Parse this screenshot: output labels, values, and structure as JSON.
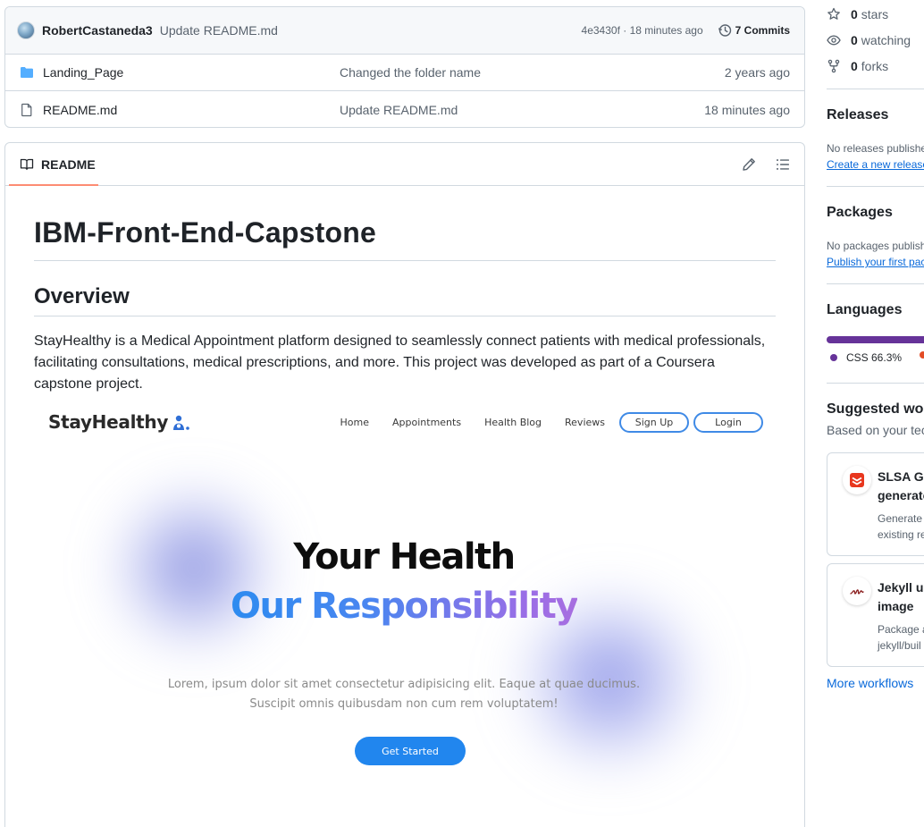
{
  "commit": {
    "author": "RobertCastaneda3",
    "message": "Update README.md",
    "hash_time": "4e3430f · 18 minutes ago",
    "commits_label": "7 Commits"
  },
  "files": [
    {
      "name": "Landing_Page",
      "type": "folder",
      "commit": "Changed the folder name",
      "date": "2 years ago"
    },
    {
      "name": "README.md",
      "type": "file",
      "commit": "Update README.md",
      "date": "18 minutes ago"
    }
  ],
  "readme": {
    "tab_label": "README",
    "title": "IBM-Front-End-Capstone",
    "overview_heading": "Overview",
    "overview_text": "StayHealthy is a Medical Appointment platform designed to seamlessly connect patients with medical professionals, facilitating consultations, medical prescriptions, and more. This project was developed as part of a Coursera capstone project."
  },
  "preview": {
    "logo": "StayHealthy",
    "nav": [
      "Home",
      "Appointments",
      "Health Blog",
      "Reviews"
    ],
    "signup": "Sign Up",
    "login": "Login",
    "headline1": "Your Health",
    "headline2": "Our Responsibility",
    "lorem": "Lorem, ipsum dolor sit amet consectetur adipisicing elit. Eaque at quae ducimus. Suscipit omnis quibusdam non cum rem voluptatem!",
    "cta": "Get Started"
  },
  "sidebar": {
    "stars_count": "0",
    "stars_label": "stars",
    "watching_count": "0",
    "watching_label": "watching",
    "forks_count": "0",
    "forks_label": "forks",
    "releases_heading": "Releases",
    "releases_text": "No releases publishe",
    "releases_link": "Create a new release",
    "packages_heading": "Packages",
    "packages_text": "No packages publish",
    "packages_link": "Publish your first pac",
    "languages_heading": "Languages",
    "lang_css_label": "CSS 66.3%",
    "lang_css_color": "#663399",
    "lang_other_color": "#e34c26",
    "workflows_heading": "Suggested wor",
    "workflows_sub": "Based on your tec",
    "workflows": [
      {
        "title1": "SLSA Ge",
        "title2": "generato",
        "desc1": "Generate",
        "desc2": "existing re"
      },
      {
        "title1": "Jekyll us",
        "title2": "image",
        "desc1": "Package a",
        "desc2": "jekyll/buil"
      }
    ],
    "more_workflows": "More workflows"
  }
}
